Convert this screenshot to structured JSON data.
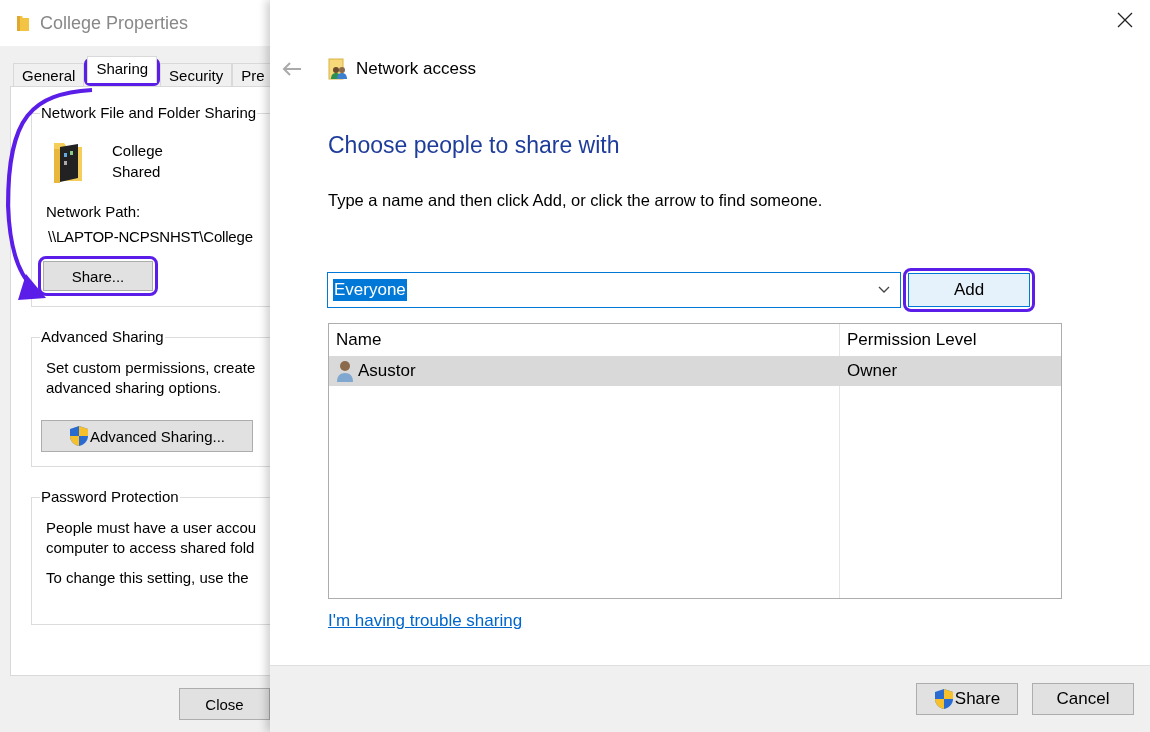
{
  "properties_window": {
    "title": "College Properties",
    "tabs": [
      {
        "label": "General",
        "selected": false
      },
      {
        "label": "Sharing",
        "selected": true,
        "highlighted": true
      },
      {
        "label": "Security",
        "selected": false
      },
      {
        "label": "Pre",
        "selected": false
      }
    ],
    "network_sharing": {
      "title": "Network File and Folder Sharing",
      "folder_name": "College",
      "status": "Shared",
      "path_label": "Network Path:",
      "path": "\\\\LAPTOP-NCPSNHST\\College",
      "button": {
        "label": "Share...",
        "highlighted": true
      }
    },
    "advanced_sharing": {
      "title": "Advanced Sharing",
      "lines": [
        "Set custom permissions, create",
        "advanced sharing options."
      ],
      "button": {
        "label": "Advanced Sharing..."
      }
    },
    "password_protection": {
      "title": "Password Protection",
      "lines": [
        "People must have a user accou",
        "computer to access shared fold"
      ],
      "note": "To change this setting, use the"
    },
    "close_button": "Close"
  },
  "share_dialog": {
    "nav_title": "Network access",
    "heading": "Choose people to share with",
    "instruction": "Type a name and then click Add, or click the arrow to find someone.",
    "name_field": {
      "value": "Everyone"
    },
    "add_button": {
      "label": "Add",
      "highlighted": true
    },
    "table": {
      "columns": [
        "Name",
        "Permission Level"
      ],
      "rows": [
        {
          "name": "Asustor",
          "permission": "Owner",
          "selected": true
        }
      ]
    },
    "trouble_link": "I'm having trouble sharing",
    "buttons": [
      {
        "label": "Share",
        "kind": "shield"
      },
      {
        "label": "Cancel",
        "kind": "plain"
      }
    ]
  }
}
